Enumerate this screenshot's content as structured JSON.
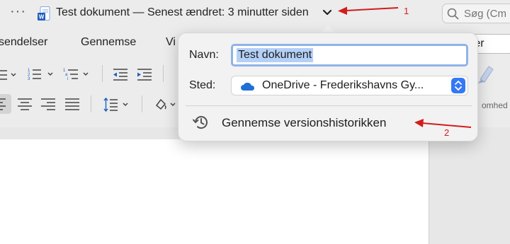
{
  "titlebar": {
    "more_label": "···",
    "document_title": "Test dokument — Senest ændret: 3 minutter siden",
    "search_placeholder": "Søg (Cm"
  },
  "ribbon": {
    "tabs": [
      {
        "label": "sendelser"
      },
      {
        "label": "Gennemse"
      },
      {
        "label": "Vi"
      }
    ],
    "share_label": "rer",
    "fragment_label": "omhed"
  },
  "popover": {
    "name_label": "Navn:",
    "name_value": "Test dokument",
    "place_label": "Sted:",
    "place_value": "OneDrive - Frederikshavns Gy...",
    "history_label": "Gennemse versionshistorikken"
  },
  "annotations": [
    {
      "label": "1"
    },
    {
      "label": "2"
    }
  ],
  "colors": {
    "annotation": "#d31c1c",
    "accent": "#3478f6",
    "selection": "#b4d0f7"
  },
  "icons": [
    "more-icon",
    "word-doc-icon",
    "chevron-down-icon",
    "search-icon",
    "bullet-list-icon",
    "numbered-list-icon",
    "multilevel-list-icon",
    "decrease-indent-icon",
    "increase-indent-icon",
    "align-left-icon",
    "align-center-icon",
    "align-right-icon",
    "justify-icon",
    "line-spacing-icon",
    "shading-icon",
    "cloud-icon",
    "history-icon"
  ]
}
